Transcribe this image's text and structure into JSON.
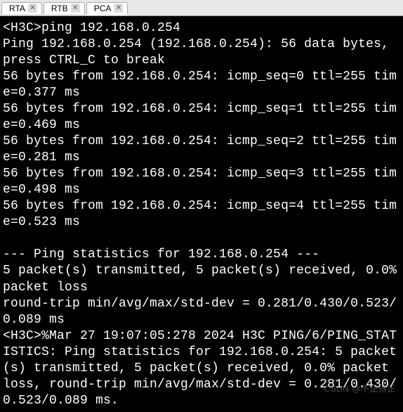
{
  "tabs": [
    {
      "label": "RTA",
      "active": false
    },
    {
      "label": "RTB",
      "active": false
    },
    {
      "label": "PCA",
      "active": true
    }
  ],
  "terminal": {
    "prompt": "<H3C>",
    "command": "ping 192.168.0.254",
    "header_l1": "Ping 192.168.0.254 (192.168.0.254): 56 data bytes, press CTRL_C to break",
    "replies": [
      "56 bytes from 192.168.0.254: icmp_seq=0 ttl=255 time=0.377 ms",
      "56 bytes from 192.168.0.254: icmp_seq=1 ttl=255 time=0.469 ms",
      "56 bytes from 192.168.0.254: icmp_seq=2 ttl=255 time=0.281 ms",
      "56 bytes from 192.168.0.254: icmp_seq=3 ttl=255 time=0.498 ms",
      "56 bytes from 192.168.0.254: icmp_seq=4 ttl=255 time=0.523 ms"
    ],
    "stats_divider": "--- Ping statistics for 192.168.0.254 ---",
    "stats_packets": "5 packet(s) transmitted, 5 packet(s) received, 0.0% packet loss",
    "stats_rtt": "round-trip min/avg/max/std-dev = 0.281/0.430/0.523/0.089 ms",
    "log_line": "<H3C>%Mar 27 19:07:05:278 2024 H3C PING/6/PING_STATISTICS: Ping statistics for 192.168.0.254: 5 packet(s) transmitted, 5 packet(s) received, 0.0% packet loss, round-trip min/avg/max/std-dev = 0.281/0.430/0.523/0.089 ms."
  },
  "watermark": "CSDN @不正得正"
}
